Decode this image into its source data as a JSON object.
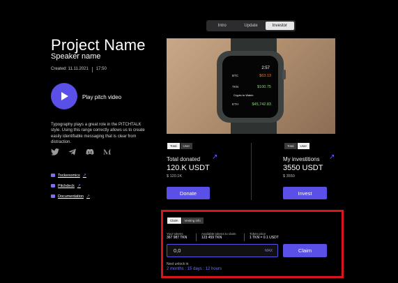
{
  "tabs": [
    {
      "label": "Intro",
      "active": false
    },
    {
      "label": "Update",
      "active": false
    },
    {
      "label": "Investor",
      "active": true
    }
  ],
  "project": {
    "title": "Project Name",
    "speaker": "Speaker name",
    "created": "Created:  11.11.2021",
    "time": "17:50",
    "play_label": "Play pitch video",
    "description": "Typography plays a great role in the PITCHTALK style. Using this range correctly allows us to create easily identifiable messaging that is clear from distraction."
  },
  "socials": [
    "twitter-icon",
    "telegram-icon",
    "discord-icon",
    "medium-icon"
  ],
  "links": [
    {
      "label": "Tockenomics"
    },
    {
      "label": "Pitchdeck"
    },
    {
      "label": "Documentation"
    }
  ],
  "watch": {
    "time": "2:57",
    "rows": [
      {
        "label": "BTC",
        "value": "$63.13"
      },
      {
        "label": "TKN",
        "value": "$100.75"
      },
      {
        "label": "Crypto to Watch",
        "value": ""
      },
      {
        "label": "ETH",
        "value": "$45,742.83"
      }
    ]
  },
  "donated": {
    "tab_total": "Total",
    "tab_user": "User",
    "title": "Total donated",
    "value": "120.K USDT",
    "sub": "$ 120.1K",
    "button": "Donate"
  },
  "investitions": {
    "tab_total": "Total",
    "tab_user": "User",
    "title": "My investitions",
    "value": "3550 USDT",
    "sub": "$ 3550",
    "button": "Invest"
  },
  "claim": {
    "tab_claim": "Claim",
    "tab_vesting": "Vesting info",
    "your_tokens_label": "Your tokens",
    "your_tokens_value": "367 987 TKN",
    "available_label": "Available tokens to claim",
    "available_value": "123 459 TKN",
    "price_label": "Token price",
    "price_value": "1 TKN = 0.1 USDT",
    "input_value": "0,0",
    "max_label": "MAX",
    "button": "Claim",
    "next_label": "Next unlock in",
    "next_value": "2 months : 15 days : 12 hours"
  },
  "colors": {
    "accent": "#5a4fe6",
    "highlight": "#d8141c",
    "background": "#000000"
  }
}
